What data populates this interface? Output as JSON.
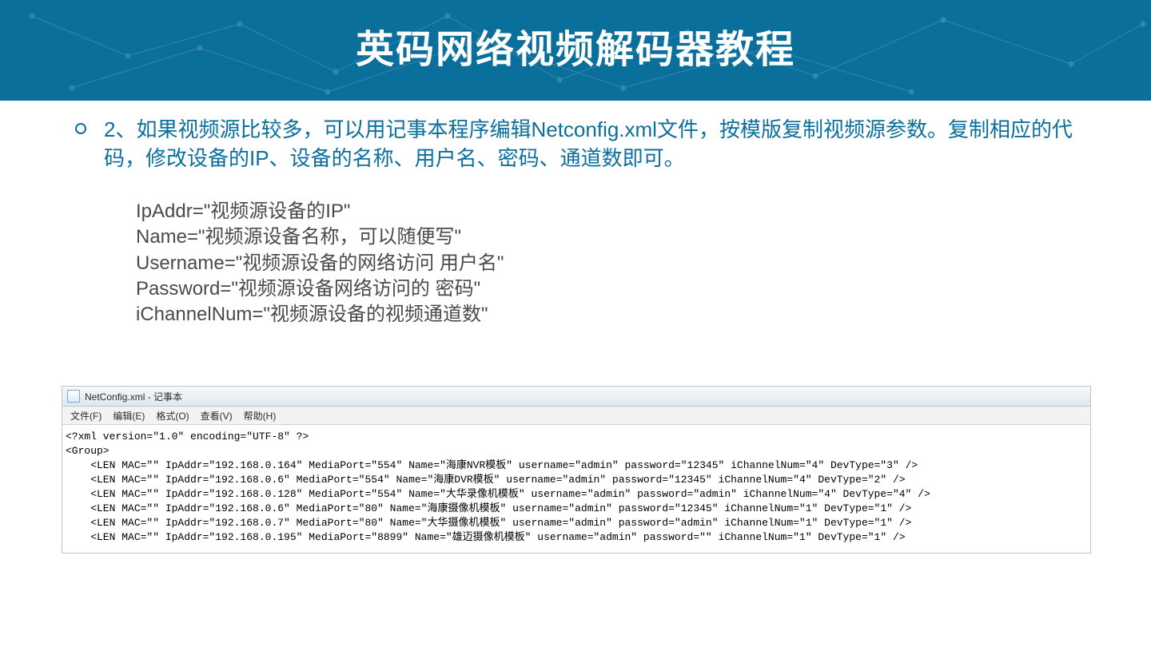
{
  "banner": {
    "title": "英码网络视频解码器教程"
  },
  "paragraph": "2、如果视频源比较多，可以用记事本程序编辑Netconfig.xml文件，按模版复制视频源参数。复制相应的代码，修改设备的IP、设备的名称、用户名、密码、通道数即可。",
  "defs": [
    "IpAddr=\"视频源设备的IP\"",
    "Name=\"视频源设备名称，可以随便写\"",
    "Username=\"视频源设备的网络访问 用户名\"",
    "Password=\"视频源设备网络访问的 密码\"",
    "iChannelNum=\"视频源设备的视频通道数\""
  ],
  "notepad": {
    "title": "NetConfig.xml - 记事本",
    "menus": [
      "文件(F)",
      "编辑(E)",
      "格式(O)",
      "查看(V)",
      "帮助(H)"
    ],
    "lines": [
      "<?xml version=\"1.0\" encoding=\"UTF-8\" ?>",
      "<Group>",
      "    <LEN MAC=\"\" IpAddr=\"192.168.0.164\" MediaPort=\"554\" Name=\"海康NVR模板\" username=\"admin\" password=\"12345\" iChannelNum=\"4\" DevType=\"3\" />",
      "    <LEN MAC=\"\" IpAddr=\"192.168.0.6\" MediaPort=\"554\" Name=\"海康DVR模板\" username=\"admin\" password=\"12345\" iChannelNum=\"4\" DevType=\"2\" />",
      "    <LEN MAC=\"\" IpAddr=\"192.168.0.128\" MediaPort=\"554\" Name=\"大华录像机模板\" username=\"admin\" password=\"admin\" iChannelNum=\"4\" DevType=\"4\" />",
      "    <LEN MAC=\"\" IpAddr=\"192.168.0.6\" MediaPort=\"80\" Name=\"海康摄像机模板\" username=\"admin\" password=\"12345\" iChannelNum=\"1\" DevType=\"1\" />",
      "    <LEN MAC=\"\" IpAddr=\"192.168.0.7\" MediaPort=\"80\" Name=\"大华摄像机模板\" username=\"admin\" password=\"admin\" iChannelNum=\"1\" DevType=\"1\" />",
      "    <LEN MAC=\"\" IpAddr=\"192.168.0.195\" MediaPort=\"8899\" Name=\"雄迈摄像机模板\" username=\"admin\" password=\"\" iChannelNum=\"1\" DevType=\"1\" />"
    ]
  }
}
